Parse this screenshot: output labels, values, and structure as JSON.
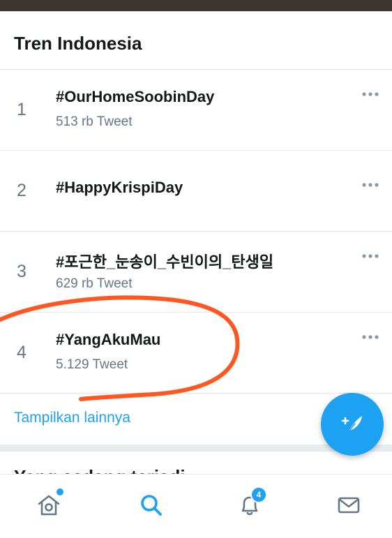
{
  "section": {
    "title": "Tren Indonesia"
  },
  "trends": [
    {
      "rank": "1",
      "tag": "#OurHomeSoobinDay",
      "count": "513 rb Tweet"
    },
    {
      "rank": "2",
      "tag": "#HappyKrispiDay",
      "count": ""
    },
    {
      "rank": "3",
      "tag": "#포근한_눈송이_수빈이의_탄생일",
      "count": "629 rb Tweet"
    },
    {
      "rank": "4",
      "tag": "#YangAkuMau",
      "count": "5.129 Tweet"
    }
  ],
  "show_more_label": "Tampilkan lainnya",
  "next_section_title": "Yang sedang terjadi",
  "notifications_badge": "4",
  "icons": {
    "more": "more-horizontal-icon",
    "compose": "compose-tweet-icon",
    "home": "home-icon",
    "search": "search-icon",
    "notifications": "bell-icon",
    "messages": "mail-icon"
  },
  "colors": {
    "accent": "#1da1f2",
    "text_primary": "#14171a",
    "text_secondary": "#657786",
    "annotation": "#ff5722"
  }
}
